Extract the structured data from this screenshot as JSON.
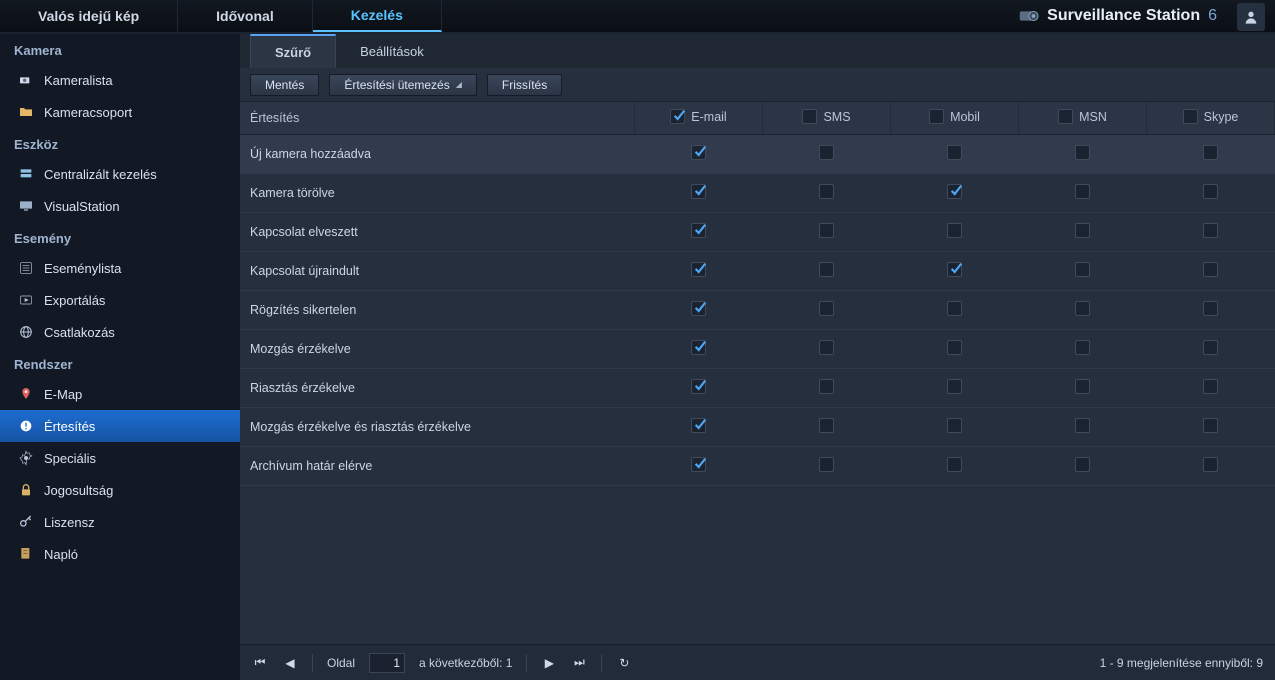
{
  "topbar": {
    "tabs": [
      {
        "label": "Valós idejű kép"
      },
      {
        "label": "Idővonal"
      },
      {
        "label": "Kezelés"
      }
    ],
    "active_tab": 2,
    "brand": "Surveillance Station",
    "brand_suffix": "6"
  },
  "sidebar": {
    "sections": [
      {
        "title": "Kamera",
        "items": [
          {
            "label": "Kameralista",
            "icon": "camera-icon"
          },
          {
            "label": "Kameracsoport",
            "icon": "folder-icon"
          }
        ]
      },
      {
        "title": "Eszköz",
        "items": [
          {
            "label": "Centralizált kezelés",
            "icon": "server-icon"
          },
          {
            "label": "VisualStation",
            "icon": "monitor-icon"
          }
        ]
      },
      {
        "title": "Esemény",
        "items": [
          {
            "label": "Eseménylista",
            "icon": "list-icon"
          },
          {
            "label": "Exportálás",
            "icon": "export-icon"
          },
          {
            "label": "Csatlakozás",
            "icon": "globe-icon"
          }
        ]
      },
      {
        "title": "Rendszer",
        "items": [
          {
            "label": "E-Map",
            "icon": "pin-icon"
          },
          {
            "label": "Értesítés",
            "icon": "alert-icon",
            "active": true
          },
          {
            "label": "Speciális",
            "icon": "gear-icon"
          },
          {
            "label": "Jogosultság",
            "icon": "lock-icon"
          },
          {
            "label": "Liszensz",
            "icon": "key-icon"
          },
          {
            "label": "Napló",
            "icon": "log-icon"
          }
        ]
      }
    ]
  },
  "inner_tabs": {
    "tabs": [
      {
        "label": "Szűrő"
      },
      {
        "label": "Beállítások"
      }
    ],
    "active": 0
  },
  "toolbar": {
    "save_label": "Mentés",
    "schedule_label": "Értesítési ütemezés",
    "refresh_label": "Frissítés"
  },
  "table": {
    "headers": {
      "notification": "Értesítés",
      "email": "E-mail",
      "sms": "SMS",
      "mobile": "Mobil",
      "msn": "MSN",
      "skype": "Skype"
    },
    "header_checked": {
      "email": true,
      "sms": false,
      "mobile": false,
      "msn": false,
      "skype": false
    },
    "rows": [
      {
        "label": "Új kamera hozzáadva",
        "email": true,
        "sms": false,
        "mobile": false,
        "msn": false,
        "skype": false
      },
      {
        "label": "Kamera törölve",
        "email": true,
        "sms": false,
        "mobile": true,
        "msn": false,
        "skype": false
      },
      {
        "label": "Kapcsolat elveszett",
        "email": true,
        "sms": false,
        "mobile": false,
        "msn": false,
        "skype": false
      },
      {
        "label": "Kapcsolat újraindult",
        "email": true,
        "sms": false,
        "mobile": true,
        "msn": false,
        "skype": false
      },
      {
        "label": "Rögzítés sikertelen",
        "email": true,
        "sms": false,
        "mobile": false,
        "msn": false,
        "skype": false
      },
      {
        "label": "Mozgás érzékelve",
        "email": true,
        "sms": false,
        "mobile": false,
        "msn": false,
        "skype": false
      },
      {
        "label": "Riasztás érzékelve",
        "email": true,
        "sms": false,
        "mobile": false,
        "msn": false,
        "skype": false
      },
      {
        "label": "Mozgás érzékelve és riasztás érzékelve",
        "email": true,
        "sms": false,
        "mobile": false,
        "msn": false,
        "skype": false
      },
      {
        "label": "Archívum határ elérve",
        "email": true,
        "sms": false,
        "mobile": false,
        "msn": false,
        "skype": false
      }
    ]
  },
  "pager": {
    "page_label": "Oldal",
    "page_value": "1",
    "of_label": "a következőből: 1",
    "summary": "1 - 9 megjelenítése ennyiből: 9"
  }
}
